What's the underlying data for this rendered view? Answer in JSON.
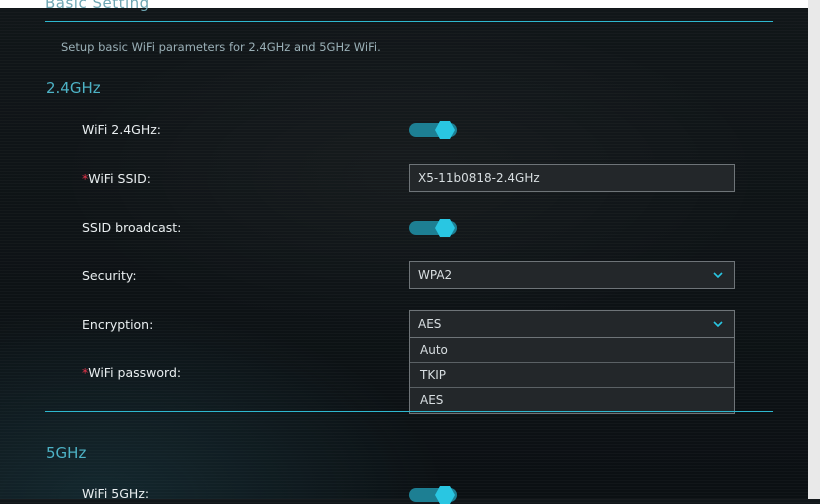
{
  "section": {
    "title": "Basic Setting",
    "description": "Setup basic WiFi parameters for 2.4GHz and 5GHz WiFi."
  },
  "band_24": {
    "heading": "2.4GHz",
    "wifi_label": "WiFi 2.4GHz:",
    "wifi_enabled": true,
    "ssid_required_mark": "*",
    "ssid_label": "WiFi SSID:",
    "ssid_value": "X5-11b0818-2.4GHz",
    "broadcast_label": "SSID broadcast:",
    "broadcast_enabled": true,
    "security_label": "Security:",
    "security_value": "WPA2",
    "encryption_label": "Encryption:",
    "encryption_value": "AES",
    "encryption_options": [
      "Auto",
      "TKIP",
      "AES"
    ],
    "password_required_mark": "*",
    "password_label": "WiFi password:"
  },
  "band_5": {
    "heading": "5GHz",
    "wifi_label": "WiFi 5GHz:",
    "wifi_enabled": true
  },
  "icons": {
    "select_arrow": "chevron-down-icon",
    "toggle": "toggle-switch"
  },
  "colors": {
    "accent": "#29c6e2",
    "toggle_track": "#1d7f93",
    "heading": "#4db2c5",
    "required": "#e4344a",
    "background": "#0c1013"
  }
}
